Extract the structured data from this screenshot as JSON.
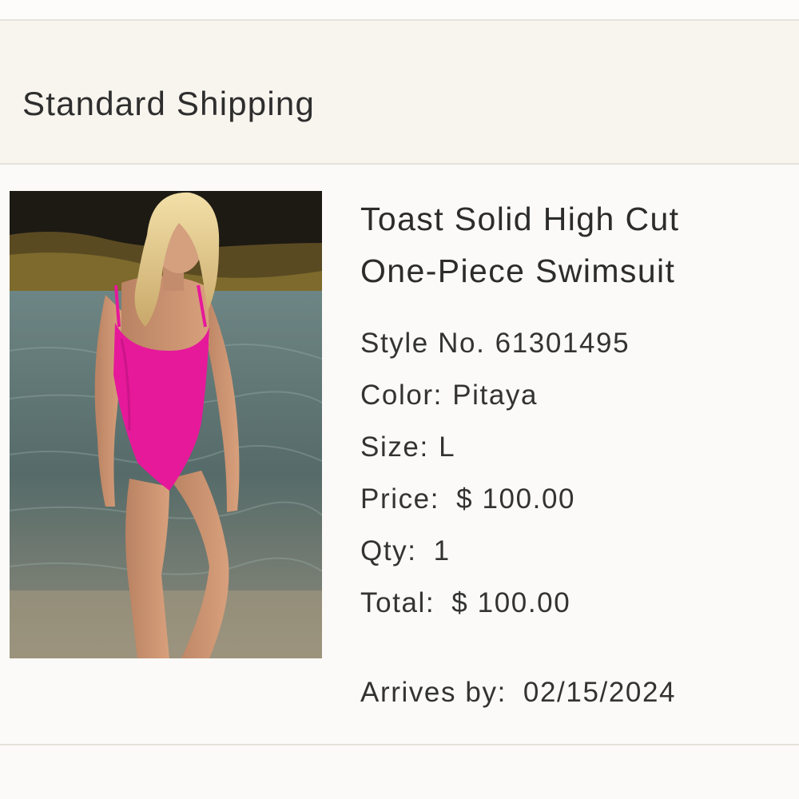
{
  "shipping": {
    "title": "Standard Shipping"
  },
  "item": {
    "name_line1": "Toast Solid High Cut",
    "name_line2": "One-Piece Swimsuit",
    "style_label": "Style No.",
    "style_value": "61301495",
    "color_label": "Color:",
    "color_value": "Pitaya",
    "size_label": "Size:",
    "size_value": "L",
    "price_label": "Price:",
    "price_value": "$ 100.00",
    "qty_label": "Qty:",
    "qty_value": "1",
    "total_label": "Total:",
    "total_value": "$ 100.00",
    "arrives_label": "Arrives by:",
    "arrives_value": "02/15/2024",
    "image_icon": "product-photo",
    "swimsuit_color": "#e6199a"
  }
}
